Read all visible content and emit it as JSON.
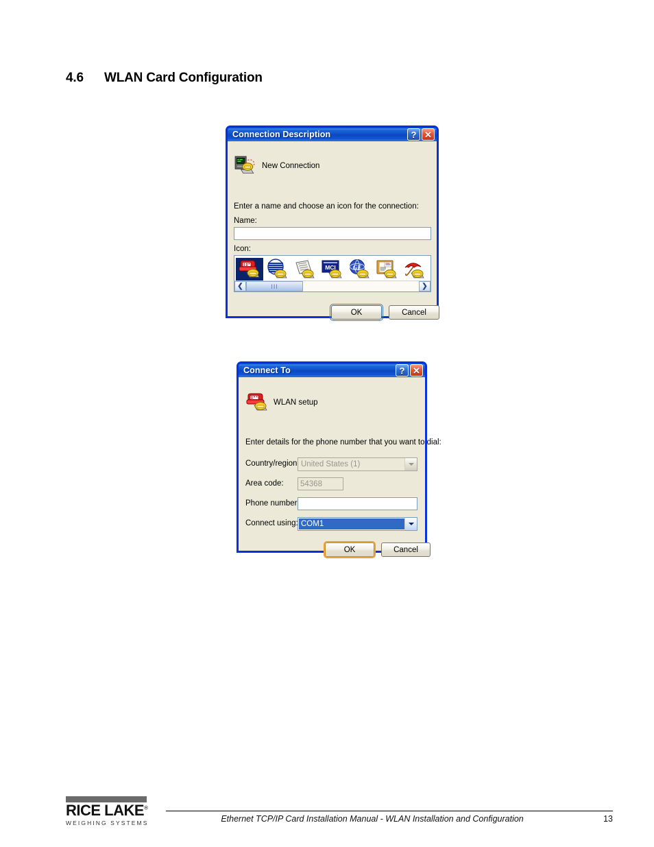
{
  "page": {
    "section_number": "4.6",
    "section_title": "WLAN Card Configuration"
  },
  "dialog1": {
    "title": "Connection Description",
    "help_button": "?",
    "close_button": "✕",
    "header_icon": "new-connection-icon",
    "header_label": "New Connection",
    "instruction": "Enter a name and choose an icon for the connection:",
    "name_label": "Name:",
    "name_value": "",
    "icon_label": "Icon:",
    "icons": [
      {
        "name": "red-telephone-icon",
        "selected": true
      },
      {
        "name": "globe-stripes-icon",
        "selected": false
      },
      {
        "name": "newspaper-icon",
        "selected": false
      },
      {
        "name": "mci-logo-icon",
        "selected": false
      },
      {
        "name": "ge-globe-icon",
        "selected": false
      },
      {
        "name": "notebook-document-icon",
        "selected": false
      },
      {
        "name": "red-umbrella-icon",
        "selected": false
      }
    ],
    "scroll_left": "❮",
    "scroll_right": "❯",
    "scroll_thumb_grip": "III",
    "ok_label": "OK",
    "cancel_label": "Cancel"
  },
  "dialog2": {
    "title": "Connect To",
    "help_button": "?",
    "close_button": "✕",
    "header_icon": "red-telephone-modem-icon",
    "header_label": "WLAN setup",
    "instruction": "Enter details for the phone number that you want to dial:",
    "fields": [
      {
        "label": "Country/region:",
        "value": "United States (1)",
        "type": "combo",
        "enabled": false
      },
      {
        "label": "Area code:",
        "value": "54368",
        "type": "text",
        "enabled": false
      },
      {
        "label": "Phone number:",
        "value": "",
        "type": "text",
        "enabled": true
      },
      {
        "label": "Connect using:",
        "value": "COM1",
        "type": "combo",
        "enabled": true
      }
    ],
    "ok_label": "OK",
    "cancel_label": "Cancel"
  },
  "footer": {
    "logo_name": "RICE LAKE",
    "logo_reg": "®",
    "logo_tagline": "WEIGHING SYSTEMS",
    "caption": "Ethernet TCP/IP Card Installation Manual - WLAN Installation and Configuration",
    "page_number": "13"
  },
  "colors": {
    "title_blue": "#0831d9",
    "dialog_face": "#ece9d8",
    "selection_blue": "#316ac5",
    "icon_select_blue": "#0a246a",
    "gold_focus": "#e8a33d"
  }
}
